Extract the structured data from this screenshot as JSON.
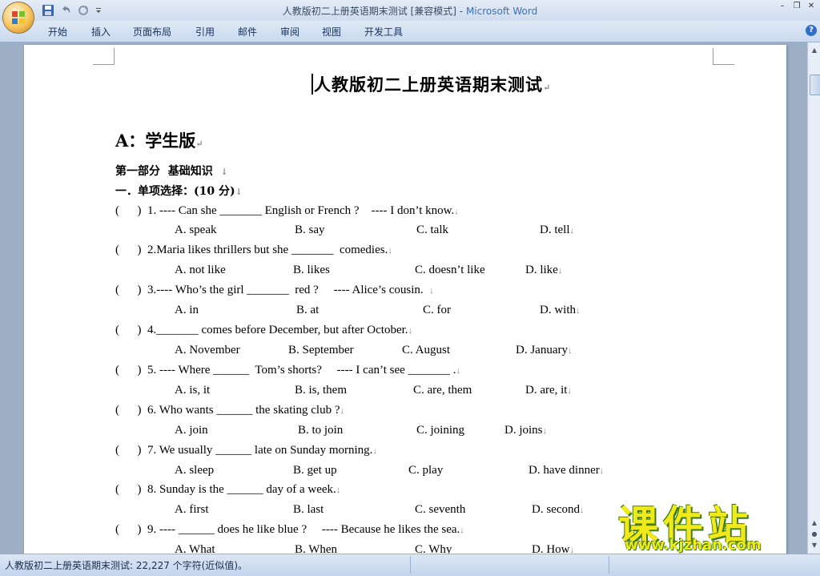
{
  "window": {
    "title": "人教版初二上册英语期末测试 [兼容模式]",
    "app_name": "Microsoft Word",
    "title_separator": " - "
  },
  "ribbon": {
    "tabs": [
      "开始",
      "插入",
      "页面布局",
      "引用",
      "邮件",
      "审阅",
      "视图",
      "开发工具"
    ]
  },
  "document": {
    "title": "人教版初二上册英语期末测试",
    "section": "A：学生版",
    "part": "第一部分  基础知识  ",
    "part_sub": "一．单项选择：(10 分)",
    "questions": [
      {
        "stem": "(      )  1. ---- Can she _______ English or French ?    ---- I don’t know.",
        "options": [
          "A. speak",
          "B. say",
          "C. talk",
          "D. tell"
        ]
      },
      {
        "stem": "(      )  2.Maria likes thrillers but she _______  comedies.",
        "options": [
          "A. not like",
          "B. likes",
          "C. doesn’t like",
          "D. like"
        ]
      },
      {
        "stem": "(      )  3.---- Who’s the girl _______  red ?     ---- Alice’s cousin.  ",
        "options": [
          "A. in",
          "B. at",
          "C. for",
          "D. with"
        ]
      },
      {
        "stem": "(      )  4._______ comes before December, but after October.",
        "options": [
          "A. November",
          "B. September",
          "C. August",
          "D. January"
        ]
      },
      {
        "stem": "(      )  5. ---- Where ______  Tom’s shorts?     ---- I can’t see _______ .",
        "options": [
          "A. is, it",
          "B. is, them",
          "C. are, them",
          "D. are, it"
        ]
      },
      {
        "stem": "(      )  6. Who wants ______ the skating club ?",
        "options": [
          "A. join",
          "B. to join",
          "C. joining",
          "D. joins"
        ]
      },
      {
        "stem": "(      )  7. We usually ______ late on Sunday morning.",
        "options": [
          "A. sleep",
          "B. get up",
          "C. play",
          "D. have dinner"
        ]
      },
      {
        "stem": "(      )  8. Sunday is the ______ day of a week.",
        "options": [
          "A. first",
          "B. last",
          "C. seventh",
          "D. second"
        ]
      },
      {
        "stem": "(      )  9. ---- ______ does he like blue ?     ---- Because he likes the sea.",
        "options": [
          "A. What",
          "B. When",
          "C. Why",
          "D. How"
        ]
      }
    ]
  },
  "status": {
    "text": "人教版初二上册英语期末测试: 22,227 个字符(近似值)。"
  },
  "watermark": {
    "chinese": "课件站",
    "url": "www.kjzhan.com"
  },
  "icons": {
    "office_button": "office-button-icon",
    "save": "save-icon",
    "undo": "undo-icon",
    "redo": "redo-icon",
    "help": "help-icon"
  }
}
